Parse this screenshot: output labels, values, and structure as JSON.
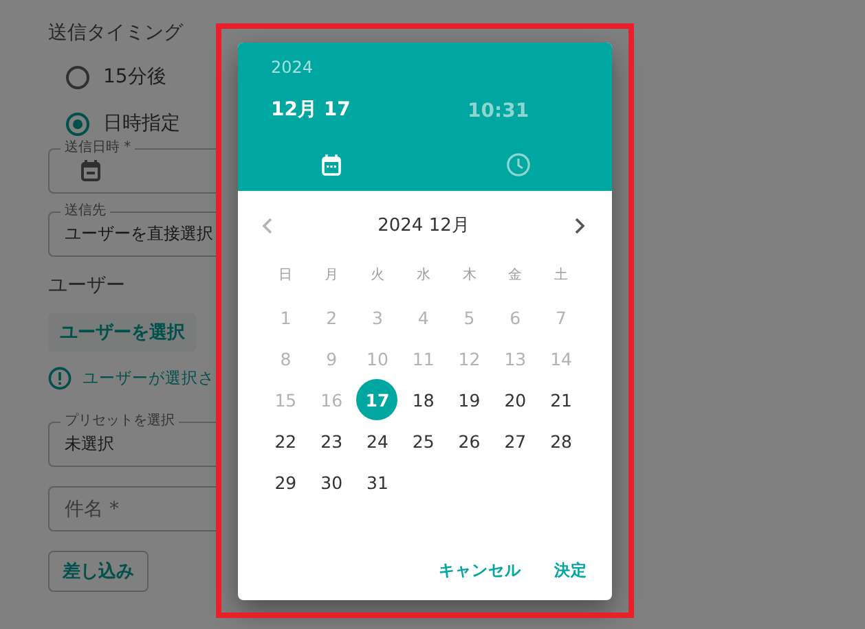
{
  "form": {
    "timing": {
      "label": "送信タイミング",
      "options": [
        {
          "label": "15分後",
          "selected": false
        },
        {
          "label": "日時指定",
          "selected": true
        }
      ]
    },
    "send_datetime": {
      "label": "送信日時 *"
    },
    "recipient": {
      "label": "送信先",
      "value": "ユーザーを直接選択"
    },
    "users": {
      "label": "ユーザー",
      "button": "ユーザーを選択",
      "warning": "ユーザーが選択さ"
    },
    "preset": {
      "label": "プリセットを選択",
      "value": "未選択"
    },
    "subject": {
      "placeholder": "件名 *"
    },
    "insert_button": "差し込み"
  },
  "picker": {
    "year": "2024",
    "header_items": [
      {
        "kind": "date",
        "text": "12月 17",
        "selected": true
      },
      {
        "kind": "time",
        "text": "10:31",
        "selected": false
      }
    ],
    "tabs": [
      {
        "kind": "calendar",
        "selected": true
      },
      {
        "kind": "clock",
        "selected": false
      }
    ],
    "month": "2024 12月",
    "prev": {
      "disabled": true
    },
    "next": {
      "disabled": false
    },
    "weekdays": [
      "日",
      "月",
      "火",
      "水",
      "木",
      "金",
      "土"
    ],
    "days": [
      {
        "label": "1",
        "disabled": true,
        "selected": false
      },
      {
        "label": "2",
        "disabled": true,
        "selected": false
      },
      {
        "label": "3",
        "disabled": true,
        "selected": false
      },
      {
        "label": "4",
        "disabled": true,
        "selected": false
      },
      {
        "label": "5",
        "disabled": true,
        "selected": false
      },
      {
        "label": "6",
        "disabled": true,
        "selected": false
      },
      {
        "label": "7",
        "disabled": true,
        "selected": false
      },
      {
        "label": "8",
        "disabled": true,
        "selected": false
      },
      {
        "label": "9",
        "disabled": true,
        "selected": false
      },
      {
        "label": "10",
        "disabled": true,
        "selected": false
      },
      {
        "label": "11",
        "disabled": true,
        "selected": false
      },
      {
        "label": "12",
        "disabled": true,
        "selected": false
      },
      {
        "label": "13",
        "disabled": true,
        "selected": false
      },
      {
        "label": "14",
        "disabled": true,
        "selected": false
      },
      {
        "label": "15",
        "disabled": true,
        "selected": false
      },
      {
        "label": "16",
        "disabled": true,
        "selected": false
      },
      {
        "label": "17",
        "disabled": false,
        "selected": true
      },
      {
        "label": "18",
        "disabled": false,
        "selected": false
      },
      {
        "label": "19",
        "disabled": false,
        "selected": false
      },
      {
        "label": "20",
        "disabled": false,
        "selected": false
      },
      {
        "label": "21",
        "disabled": false,
        "selected": false
      },
      {
        "label": "22",
        "disabled": false,
        "selected": false
      },
      {
        "label": "23",
        "disabled": false,
        "selected": false
      },
      {
        "label": "24",
        "disabled": false,
        "selected": false
      },
      {
        "label": "25",
        "disabled": false,
        "selected": false
      },
      {
        "label": "26",
        "disabled": false,
        "selected": false
      },
      {
        "label": "27",
        "disabled": false,
        "selected": false
      },
      {
        "label": "28",
        "disabled": false,
        "selected": false
      },
      {
        "label": "29",
        "disabled": false,
        "selected": false
      },
      {
        "label": "30",
        "disabled": false,
        "selected": false
      },
      {
        "label": "31",
        "disabled": false,
        "selected": false
      }
    ],
    "actions": [
      "キャンセル",
      "決定"
    ]
  }
}
